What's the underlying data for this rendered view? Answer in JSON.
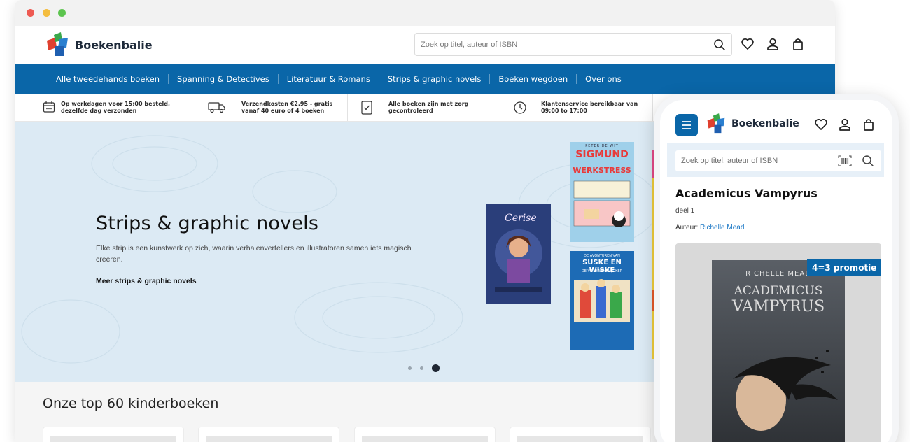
{
  "site": {
    "brand_name": "Boekenbalie",
    "colors": {
      "primary": "#0a66a8",
      "hero_bg": "#dceaf4",
      "link": "#1574c4"
    }
  },
  "header": {
    "search_placeholder": "Zoek op titel, auteur of ISBN",
    "icons": [
      "search-icon",
      "heart-icon",
      "user-icon",
      "bag-icon"
    ]
  },
  "nav": {
    "items": [
      "Alle tweedehands boeken",
      "Spanning & Detectives",
      "Literatuur & Romans",
      "Strips & graphic novels",
      "Boeken wegdoen",
      "Over ons"
    ]
  },
  "usps": [
    {
      "icon": "calendar-icon",
      "line1": "Op werkdagen voor 15:00 besteld,",
      "line2": "dezelfde dag verzonden"
    },
    {
      "icon": "truck-icon",
      "line1": "Verzendkosten €2,95 - gratis",
      "line2": "vanaf 40 euro of 4 boeken"
    },
    {
      "icon": "checklist-icon",
      "line1": "Alle boeken zijn met zorg",
      "line2": "gecontroleerd"
    },
    {
      "icon": "clock-icon",
      "line1": "Klantenservice bereikbaar van",
      "line2": "09:00 to 17:00"
    }
  ],
  "hero": {
    "title": "Strips & graphic novels",
    "description": "Elke strip is een kunstwerk op zich, waarin verhalenvertellers en illustratoren samen iets magisch creëren.",
    "link": "Meer strips & graphic novels",
    "books": [
      {
        "title": "SIGMUND",
        "subtitle": "WERKSTRESS",
        "top_text": "PETER DE WIT"
      },
      {
        "title": "SUSKE EN WISKE",
        "subtitle": "DE VERDWENEN JOKER",
        "top_text": "DE AVONTUREN VAN"
      },
      {
        "title": "Cerise"
      }
    ]
  },
  "top_section": {
    "title": "Onze top 60 kinderboeken"
  },
  "mobile": {
    "search_placeholder": "Zoek op titel, auteur of ISBN",
    "product_title": "Academicus Vampyrus",
    "volume": "deel 1",
    "author_label": "Auteur:",
    "author_name": "Richelle Mead",
    "badge": "4=3 promotie",
    "cover": {
      "author": "RICHELLE MEAD",
      "title_line1": "ACADEMICUS",
      "title_line2": "VAMPYRUS"
    }
  }
}
